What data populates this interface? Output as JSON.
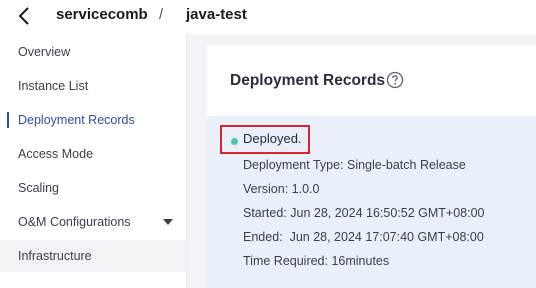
{
  "breadcrumb": {
    "parent": "servicecomb",
    "separator": "/",
    "current": "java-test"
  },
  "sidebar": {
    "items": [
      {
        "label": "Overview"
      },
      {
        "label": "Instance List"
      },
      {
        "label": "Deployment Records"
      },
      {
        "label": "Access Mode"
      },
      {
        "label": "Scaling"
      },
      {
        "label": "O&M Configurations"
      },
      {
        "label": "Infrastructure"
      }
    ]
  },
  "main": {
    "title": "Deployment Records",
    "record": {
      "status": "Deployed.",
      "status_color": "#4fc7a8",
      "deployment_type": "Deployment Type: Single-batch Release",
      "version": "Version: 1.0.0",
      "started": "Started: Jun 28, 2024 16:50:52 GMT+08:00",
      "ended": "Ended:  Jun 28, 2024 17:07:40 GMT+08:00",
      "time_required": "Time Required: 16minutes"
    }
  },
  "colors": {
    "accent": "#2b4fa8",
    "highlight_border": "#d9232f",
    "record_background": "#eaf0fa"
  },
  "icons": {
    "back": "chevron-left-icon",
    "help": "question-circle-icon",
    "expand": "chevron-down-icon"
  }
}
